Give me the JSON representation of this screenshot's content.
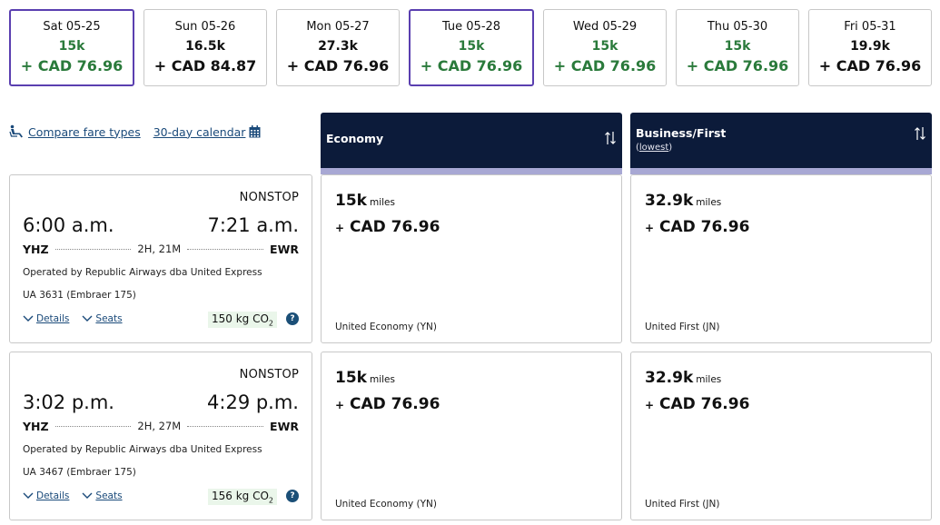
{
  "date_strip": [
    {
      "label": "Sat 05-25",
      "miles": "15k",
      "price": "+ CAD 76.96",
      "lowest": true,
      "selected": true
    },
    {
      "label": "Sun 05-26",
      "miles": "16.5k",
      "price": "+ CAD 84.87",
      "lowest": false,
      "selected": false
    },
    {
      "label": "Mon 05-27",
      "miles": "27.3k",
      "price": "+ CAD 76.96",
      "lowest": false,
      "selected": false
    },
    {
      "label": "Tue 05-28",
      "miles": "15k",
      "price": "+ CAD 76.96",
      "lowest": true,
      "selected": true
    },
    {
      "label": "Wed 05-29",
      "miles": "15k",
      "price": "+ CAD 76.96",
      "lowest": true,
      "selected": false
    },
    {
      "label": "Thu 05-30",
      "miles": "15k",
      "price": "+ CAD 76.96",
      "lowest": true,
      "selected": false
    },
    {
      "label": "Fri 05-31",
      "miles": "19.9k",
      "price": "+ CAD 76.96",
      "lowest": false,
      "selected": false
    }
  ],
  "links": {
    "compare_fare_types": "Compare fare types",
    "calendar_30_day": "30-day calendar"
  },
  "columns": {
    "economy": {
      "title": "Economy"
    },
    "business": {
      "title": "Business/First",
      "subtitle_prefix": "(",
      "subtitle_link": "lowest",
      "subtitle_suffix": ")"
    }
  },
  "colors": {
    "lowest_green": "#2a7a3b",
    "selected_border": "#5a3fb0",
    "header_navy": "#0c1b3a",
    "header_stripe": "#a8a8d4",
    "link_blue": "#1a4a7a",
    "co2_bg": "#eaf6ea"
  },
  "flights": [
    {
      "stops": "NONSTOP",
      "depart_time": "6:00 a.m.",
      "arrive_time": "7:21 a.m.",
      "origin": "YHZ",
      "destination": "EWR",
      "duration": "2H, 21M",
      "operator": "Operated by Republic Airways dba United Express",
      "flight_number": "UA 3631 (Embraer 175)",
      "details_label": "Details",
      "seats_label": "Seats",
      "co2": "150 kg CO",
      "co2_sub": "2",
      "help": "?",
      "economy": {
        "miles": "15k",
        "miles_unit": "miles",
        "plus": "+",
        "price": "CAD 76.96",
        "fare_name": "United Economy (YN)"
      },
      "business": {
        "miles": "32.9k",
        "miles_unit": "miles",
        "plus": "+",
        "price": "CAD 76.96",
        "fare_name": "United First (JN)"
      }
    },
    {
      "stops": "NONSTOP",
      "depart_time": "3:02 p.m.",
      "arrive_time": "4:29 p.m.",
      "origin": "YHZ",
      "destination": "EWR",
      "duration": "2H, 27M",
      "operator": "Operated by Republic Airways dba United Express",
      "flight_number": "UA 3467 (Embraer 175)",
      "details_label": "Details",
      "seats_label": "Seats",
      "co2": "156 kg CO",
      "co2_sub": "2",
      "help": "?",
      "economy": {
        "miles": "15k",
        "miles_unit": "miles",
        "plus": "+",
        "price": "CAD 76.96",
        "fare_name": "United Economy (YN)"
      },
      "business": {
        "miles": "32.9k",
        "miles_unit": "miles",
        "plus": "+",
        "price": "CAD 76.96",
        "fare_name": "United First (JN)"
      }
    }
  ]
}
